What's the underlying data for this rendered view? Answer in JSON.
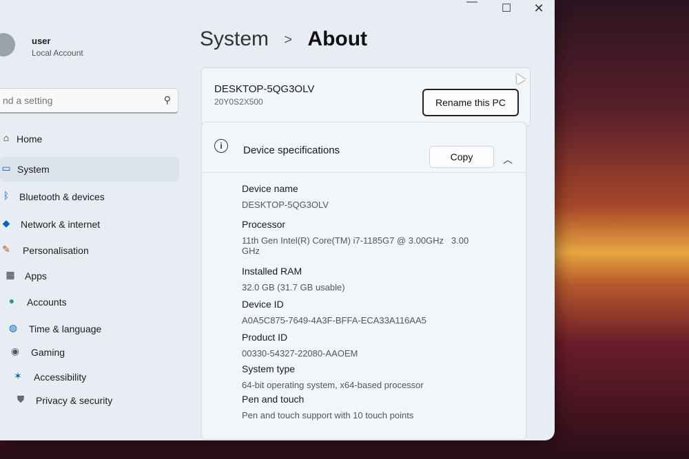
{
  "window": {
    "minimize_icon": "minimize-icon",
    "maximize_icon": "maximize-icon",
    "close_icon": "close-icon"
  },
  "profile": {
    "name": "user",
    "account_type": "Local Account"
  },
  "search": {
    "placeholder": "nd a setting"
  },
  "sidebar": {
    "items": [
      {
        "label": "Home",
        "icon": "home-icon"
      },
      {
        "label": "System",
        "icon": "system-icon",
        "active": true
      },
      {
        "label": "Bluetooth & devices",
        "icon": "bluetooth-icon"
      },
      {
        "label": "Network & internet",
        "icon": "wifi-icon"
      },
      {
        "label": "Personalisation",
        "icon": "brush-icon"
      },
      {
        "label": "Apps",
        "icon": "apps-icon"
      },
      {
        "label": "Accounts",
        "icon": "person-icon"
      },
      {
        "label": "Time & language",
        "icon": "globe-icon"
      },
      {
        "label": "Gaming",
        "icon": "controller-icon"
      },
      {
        "label": "Accessibility",
        "icon": "accessibility-icon"
      },
      {
        "label": "Privacy & security",
        "icon": "shield-icon"
      }
    ]
  },
  "breadcrumb": {
    "parent": "System",
    "separator": ">",
    "current": "About"
  },
  "device_card": {
    "name": "DESKTOP-5QG3OLV",
    "model": "20Y0S2X500",
    "rename_label": "Rename this PC"
  },
  "specs": {
    "title": "Device specifications",
    "copy_label": "Copy",
    "rows": [
      {
        "label": "Device name",
        "value": "DESKTOP-5QG3OLV"
      },
      {
        "label": "Processor",
        "value": "11th Gen Intel(R) Core(TM) i7-1185G7 @ 3.00GHz   3.00",
        "value2": "GHz"
      },
      {
        "label": "Installed RAM",
        "value": "32.0 GB (31.7 GB usable)"
      },
      {
        "label": "Device ID",
        "value": "A0A5C875-7649-4A3F-BFFA-ECA33A116AA5"
      },
      {
        "label": "Product ID",
        "value": "00330-54327-22080-AAOEM"
      },
      {
        "label": "System type",
        "value": "64-bit operating system, x64-based processor"
      },
      {
        "label": "Pen and touch",
        "value": "Pen and touch support with 10 touch points"
      }
    ]
  },
  "colors": {
    "window_bg": "#e8edf3",
    "card_bg": "#f3f6f9",
    "accent": "#0067c0"
  }
}
